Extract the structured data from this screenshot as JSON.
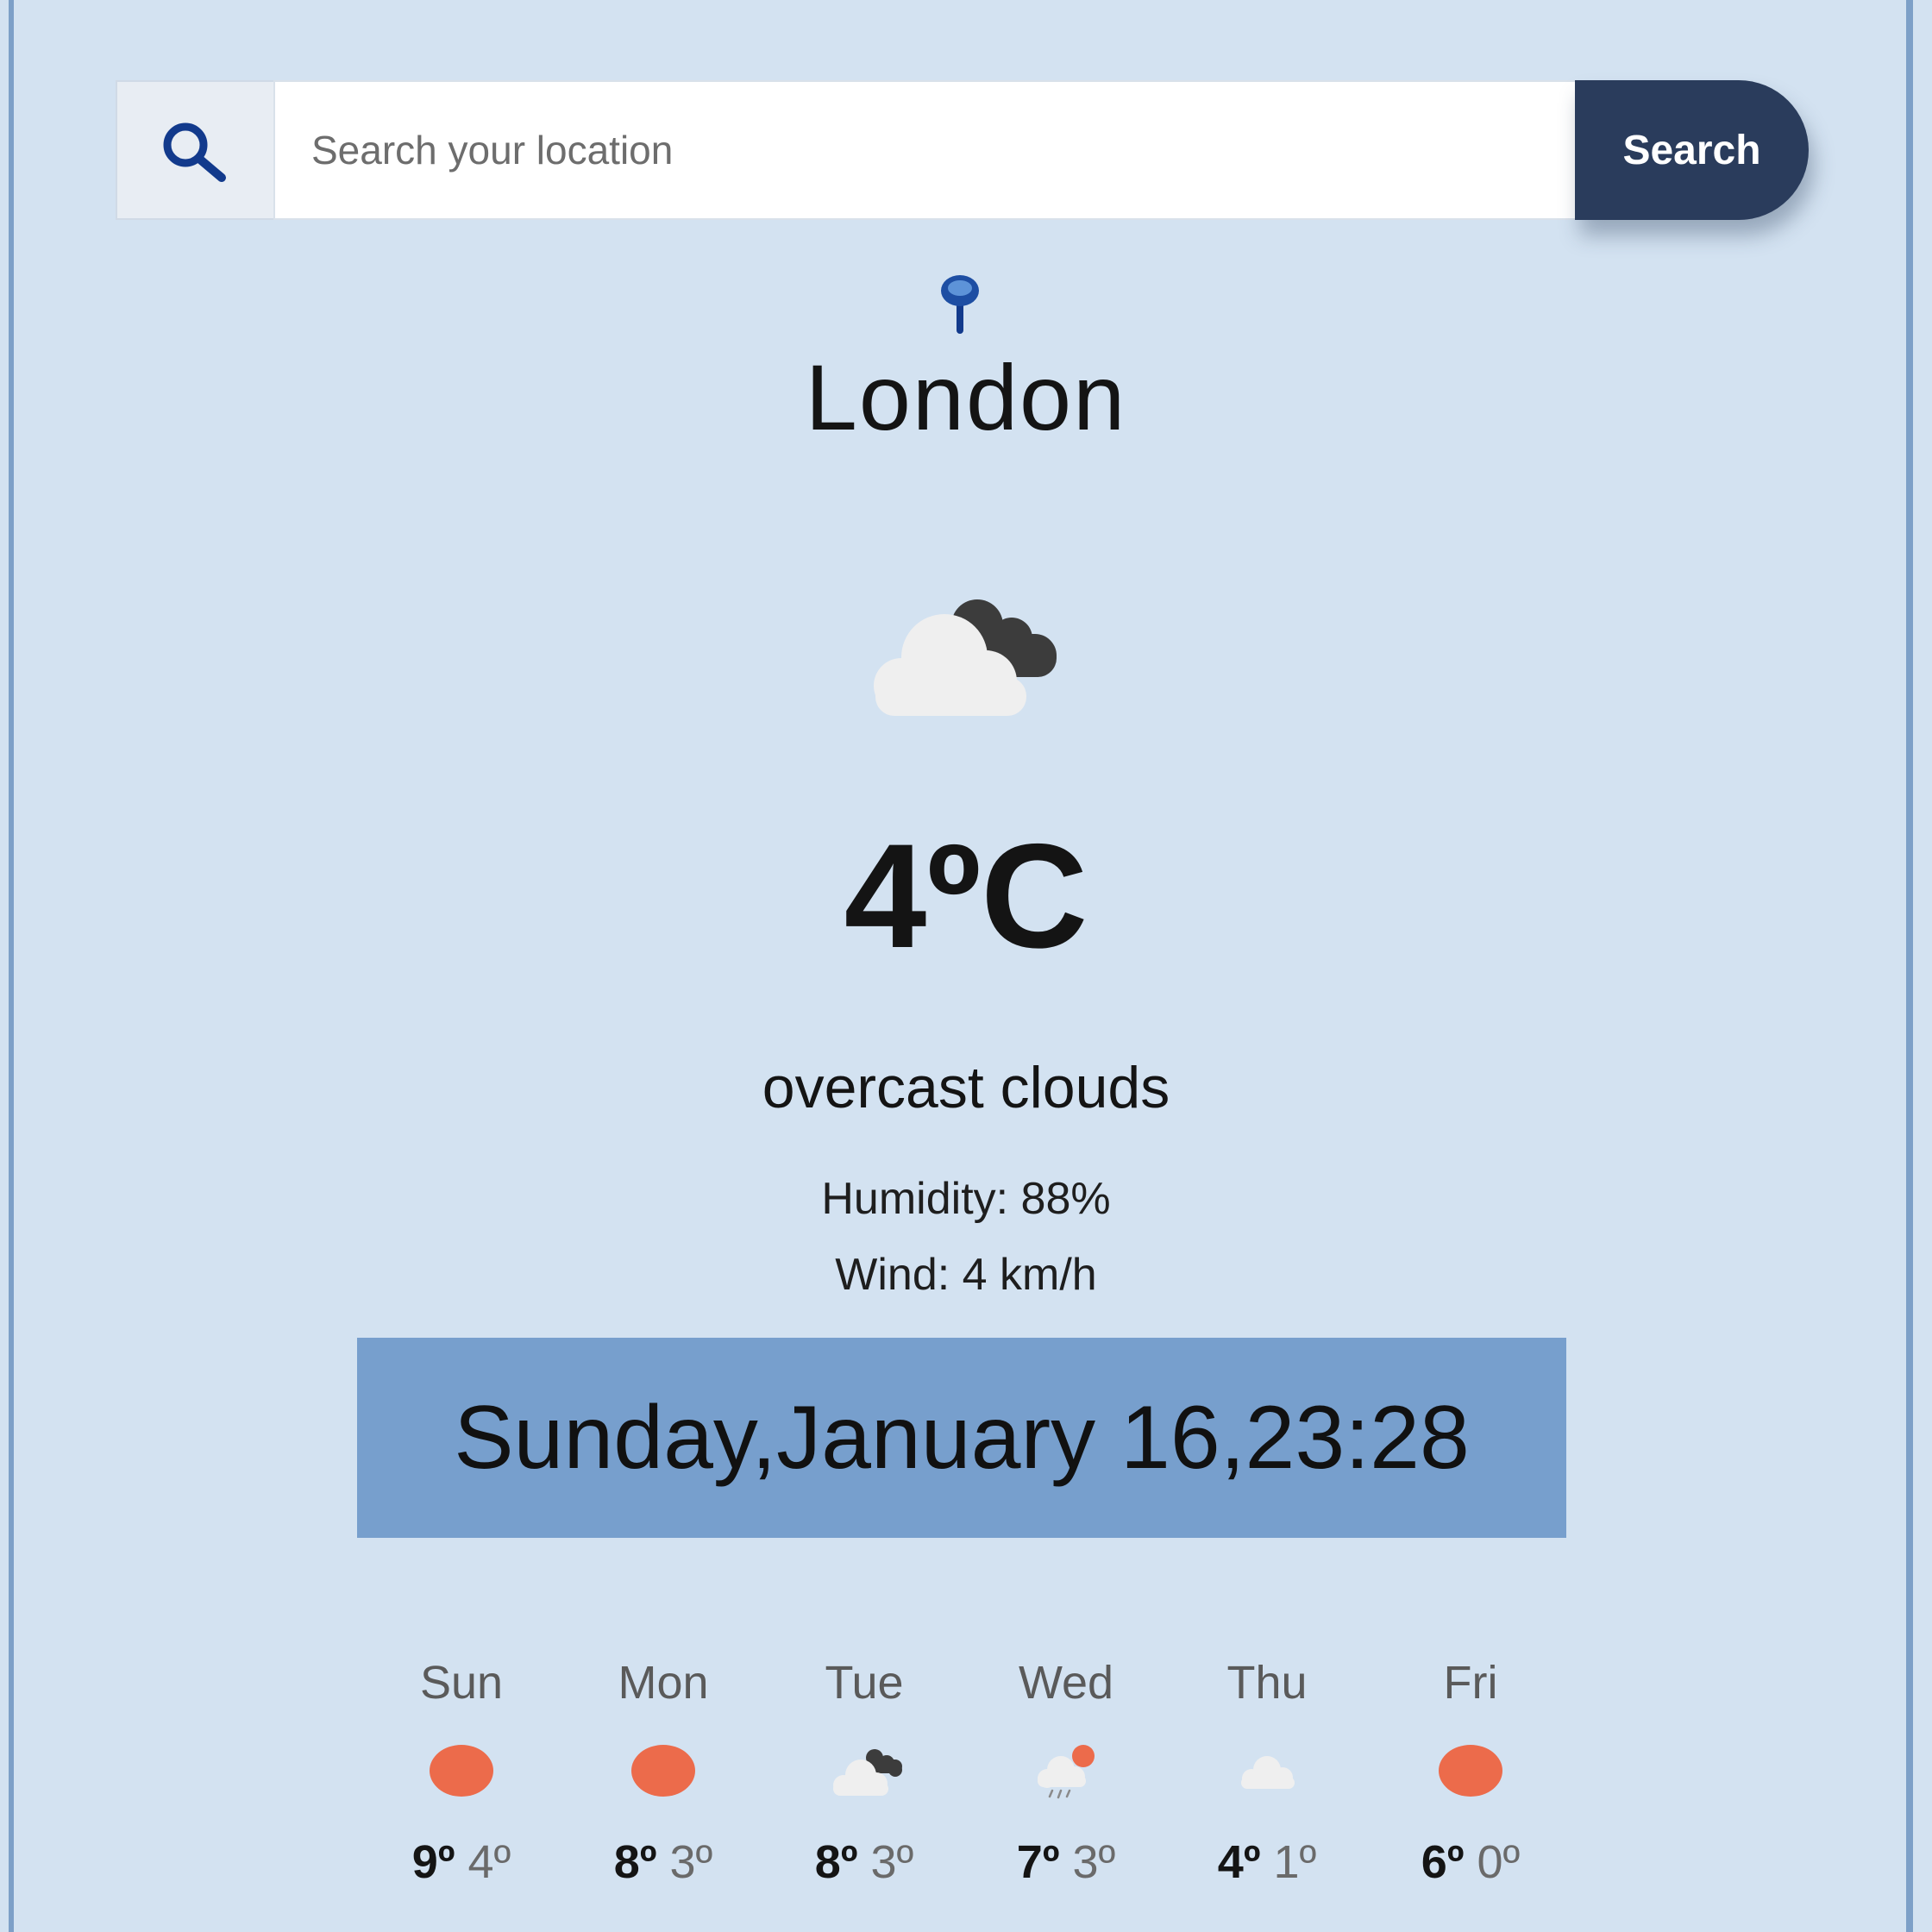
{
  "search": {
    "placeholder": "Search your location",
    "value": "",
    "button_label": "Search",
    "icon": "search-icon"
  },
  "location": {
    "icon": "map-pin-icon",
    "city": "London"
  },
  "current": {
    "icon": "broken-clouds-icon",
    "temperature": "4ºC",
    "description": "overcast clouds",
    "humidity": "Humidity: 88%",
    "wind": "Wind: 4 km/h"
  },
  "datetime": "Sunday,January 16,23:28",
  "forecast": [
    {
      "day": "Sun",
      "icon": "sun-icon",
      "max": "9º",
      "min": "4º"
    },
    {
      "day": "Mon",
      "icon": "sun-icon",
      "max": "8º",
      "min": "3º"
    },
    {
      "day": "Tue",
      "icon": "broken-clouds-icon",
      "max": "8º",
      "min": "3º"
    },
    {
      "day": "Wed",
      "icon": "rain-sun-icon",
      "max": "7º",
      "min": "3º"
    },
    {
      "day": "Thu",
      "icon": "cloud-icon",
      "max": "4º",
      "min": "1º"
    },
    {
      "day": "Fri",
      "icon": "sun-icon",
      "max": "6º",
      "min": "0º"
    }
  ],
  "colors": {
    "background": "#d3e2f1",
    "search_button": "#2a3c5c",
    "date_bar": "#779fcd",
    "sun": "#ec6b4b",
    "icon_blue": "#123a8c"
  }
}
